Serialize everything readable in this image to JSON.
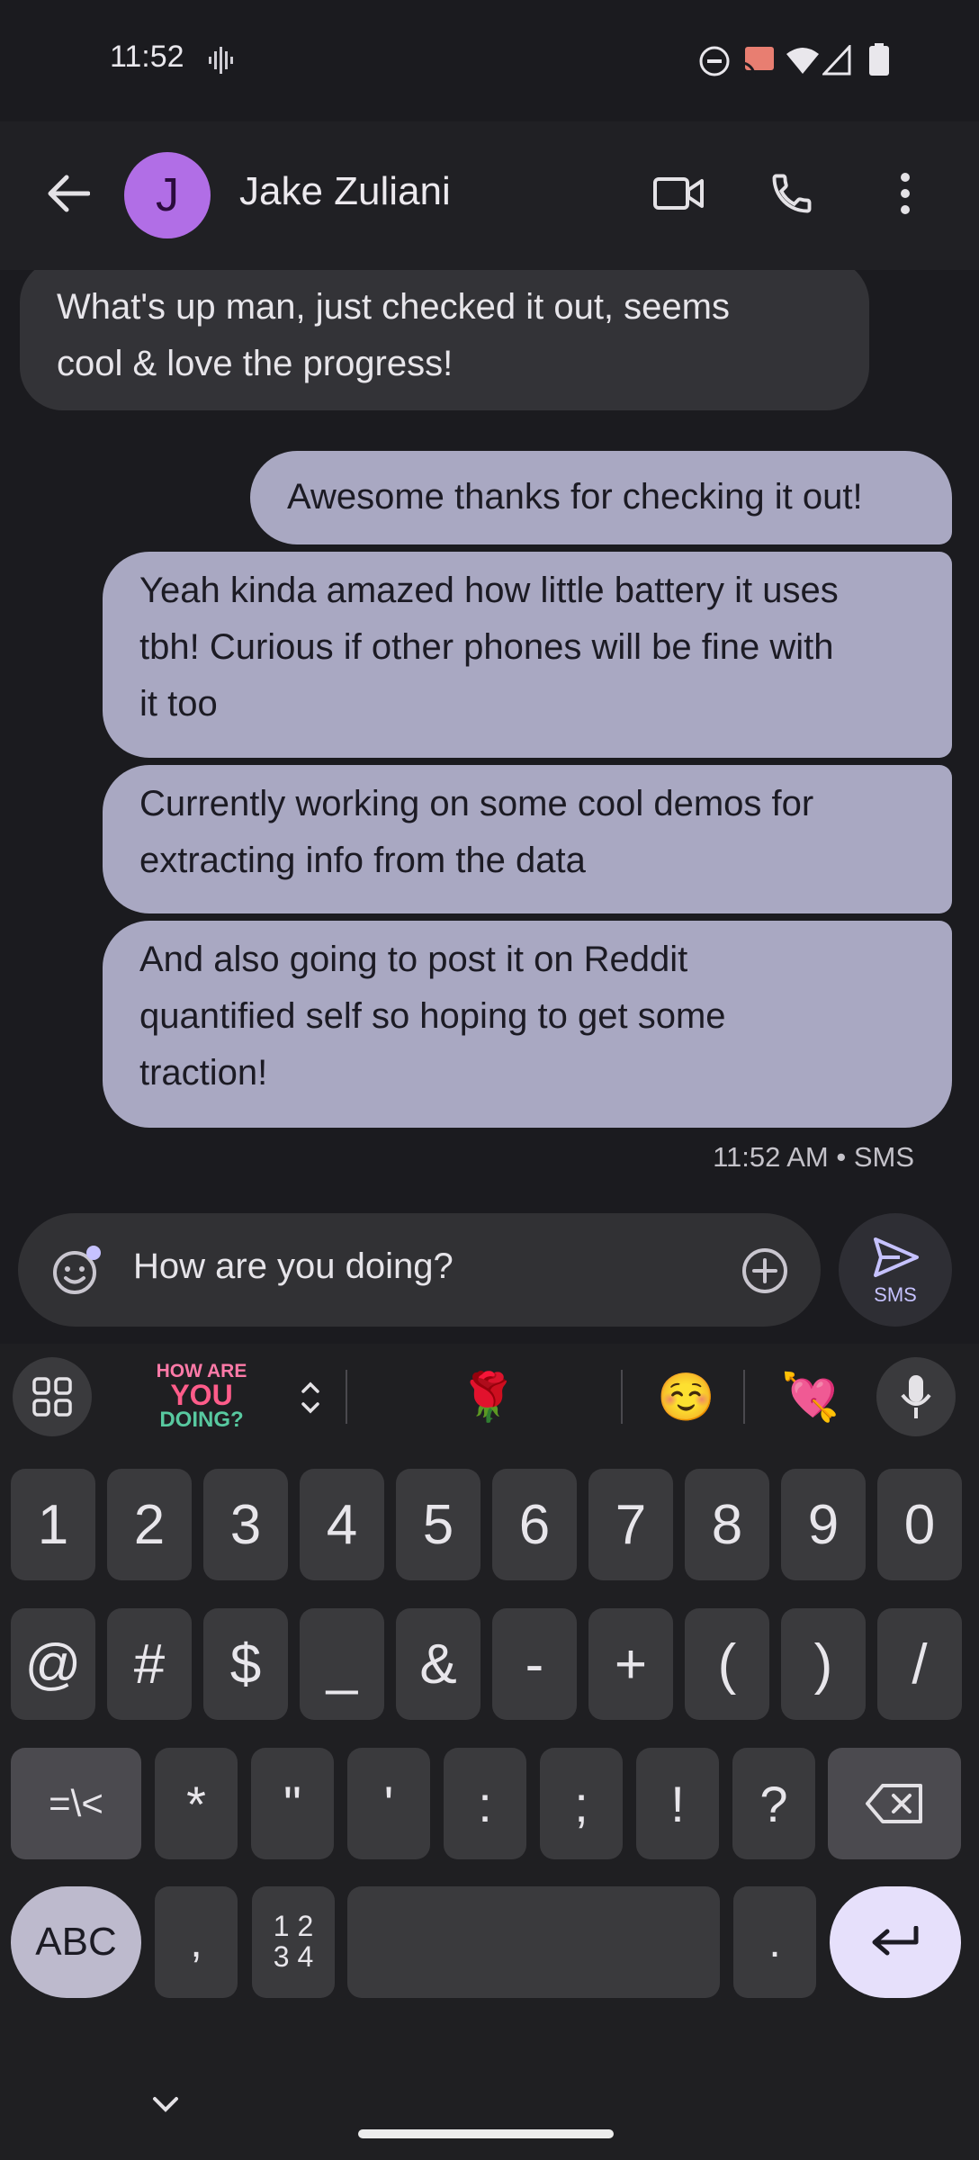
{
  "status": {
    "time": "11:52"
  },
  "header": {
    "avatar_letter": "J",
    "contact_name": "Jake Zuliani"
  },
  "messages": {
    "incoming_1": [
      "What's up man, just checked it out, seems",
      "cool & love the progress!"
    ],
    "outgoing": [
      [
        "Awesome thanks for checking it out!"
      ],
      [
        "Yeah kinda amazed how little battery it uses",
        "tbh! Curious if other phones will be fine with",
        "it too"
      ],
      [
        "Currently working on some cool demos for",
        "extracting info from the data"
      ],
      [
        "And also going to post it on Reddit",
        "quantified self so hoping to get some",
        "traction!"
      ]
    ],
    "timestamp": "11:52 AM • SMS"
  },
  "compose": {
    "text": "How are you doing?",
    "send_label": "SMS"
  },
  "keyboard": {
    "sticker_lines": [
      "HOW ARE",
      "YOU",
      "DOING?"
    ],
    "suggestion_emojis": [
      "🌹",
      "☺️",
      "💘"
    ],
    "row1": [
      "1",
      "2",
      "3",
      "4",
      "5",
      "6",
      "7",
      "8",
      "9",
      "0"
    ],
    "row2": [
      "@",
      "#",
      "$",
      "_",
      "&",
      "-",
      "+",
      "(",
      ")",
      "/"
    ],
    "row3_left": "=\\<",
    "row3": [
      "*",
      "\"",
      "'",
      ":",
      ";",
      "!",
      "?"
    ],
    "abc_label": "ABC",
    "comma": ",",
    "numpad_label_top": "1 2",
    "numpad_label_bottom": "3 4",
    "period": "."
  }
}
